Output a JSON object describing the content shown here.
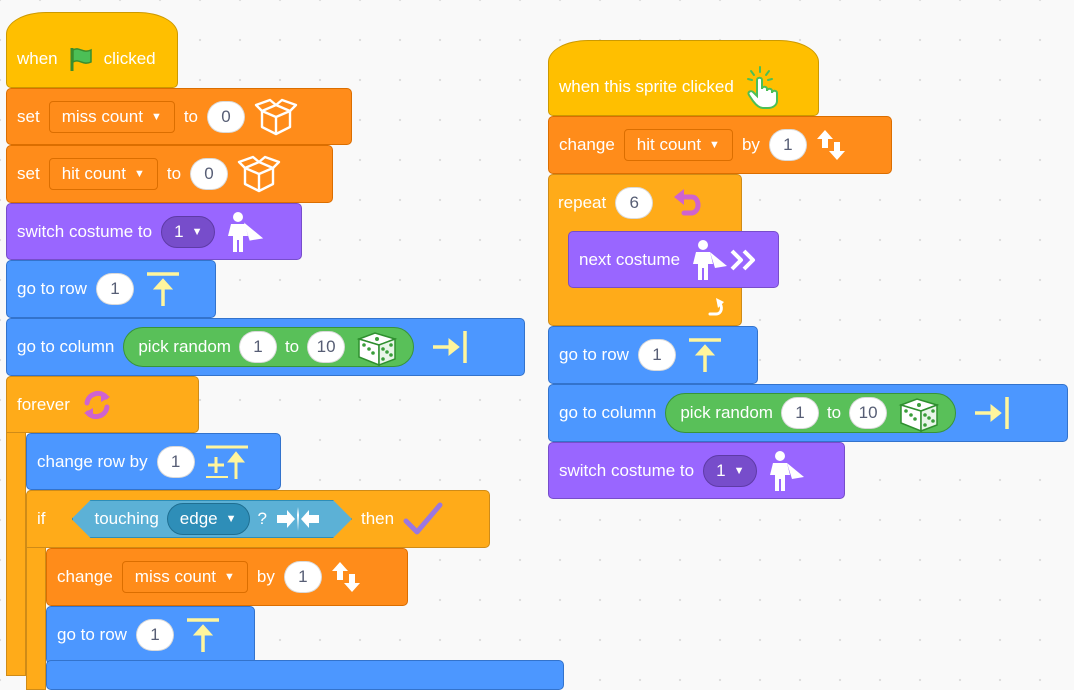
{
  "script1": {
    "when_flag": {
      "when": "when",
      "clicked": "clicked"
    },
    "set_miss": {
      "op": "set",
      "variable": "miss count",
      "to": "to",
      "value": "0"
    },
    "set_hit": {
      "op": "set",
      "variable": "hit count",
      "to": "to",
      "value": "0"
    },
    "switch_costume": {
      "label": "switch costume to",
      "value": "1"
    },
    "go_to_row": {
      "label": "go to row",
      "value": "1"
    },
    "go_to_column": {
      "label": "go to column",
      "pick_random": "pick random",
      "from": "1",
      "to": "to",
      "max": "10"
    },
    "forever": {
      "label": "forever"
    },
    "change_row": {
      "label": "change row by",
      "value": "1"
    },
    "if_touching": {
      "if": "if",
      "touching": "touching",
      "target": "edge",
      "q": "?",
      "then": "then"
    },
    "change_miss": {
      "label": "change",
      "variable": "miss count",
      "by": "by",
      "value": "1"
    },
    "go_to_row_2": {
      "label": "go to row",
      "value": "1"
    }
  },
  "script2": {
    "when_sprite_clicked": {
      "label": "when this sprite clicked"
    },
    "change_hit": {
      "label": "change",
      "variable": "hit count",
      "by": "by",
      "value": "1"
    },
    "repeat": {
      "label": "repeat",
      "value": "6"
    },
    "next_costume": {
      "label": "next costume"
    },
    "go_to_row": {
      "label": "go to row",
      "value": "1"
    },
    "go_to_column": {
      "label": "go to column",
      "pick_random": "pick random",
      "from": "1",
      "to": "to",
      "max": "10"
    },
    "switch_costume": {
      "label": "switch costume to",
      "value": "1"
    }
  },
  "colors": {
    "motion": "#4c97ff",
    "control": "#ffab19",
    "variables": "#ff8c1a",
    "looks": "#9966ff",
    "events": "#ffbf00",
    "sensing": "#5cb1d6",
    "operators": "#59c059"
  },
  "icons": [
    "green-flag-icon",
    "box-icon",
    "superhero-icon",
    "arrow-up-icon",
    "arrow-right-bar-icon",
    "dice-icon",
    "loop-icon",
    "row-plus-icon",
    "collision-icon",
    "checkmark-icon",
    "hand-click-icon",
    "updown-arrows-icon",
    "repeat-arrow-icon",
    "double-chevron-icon"
  ]
}
